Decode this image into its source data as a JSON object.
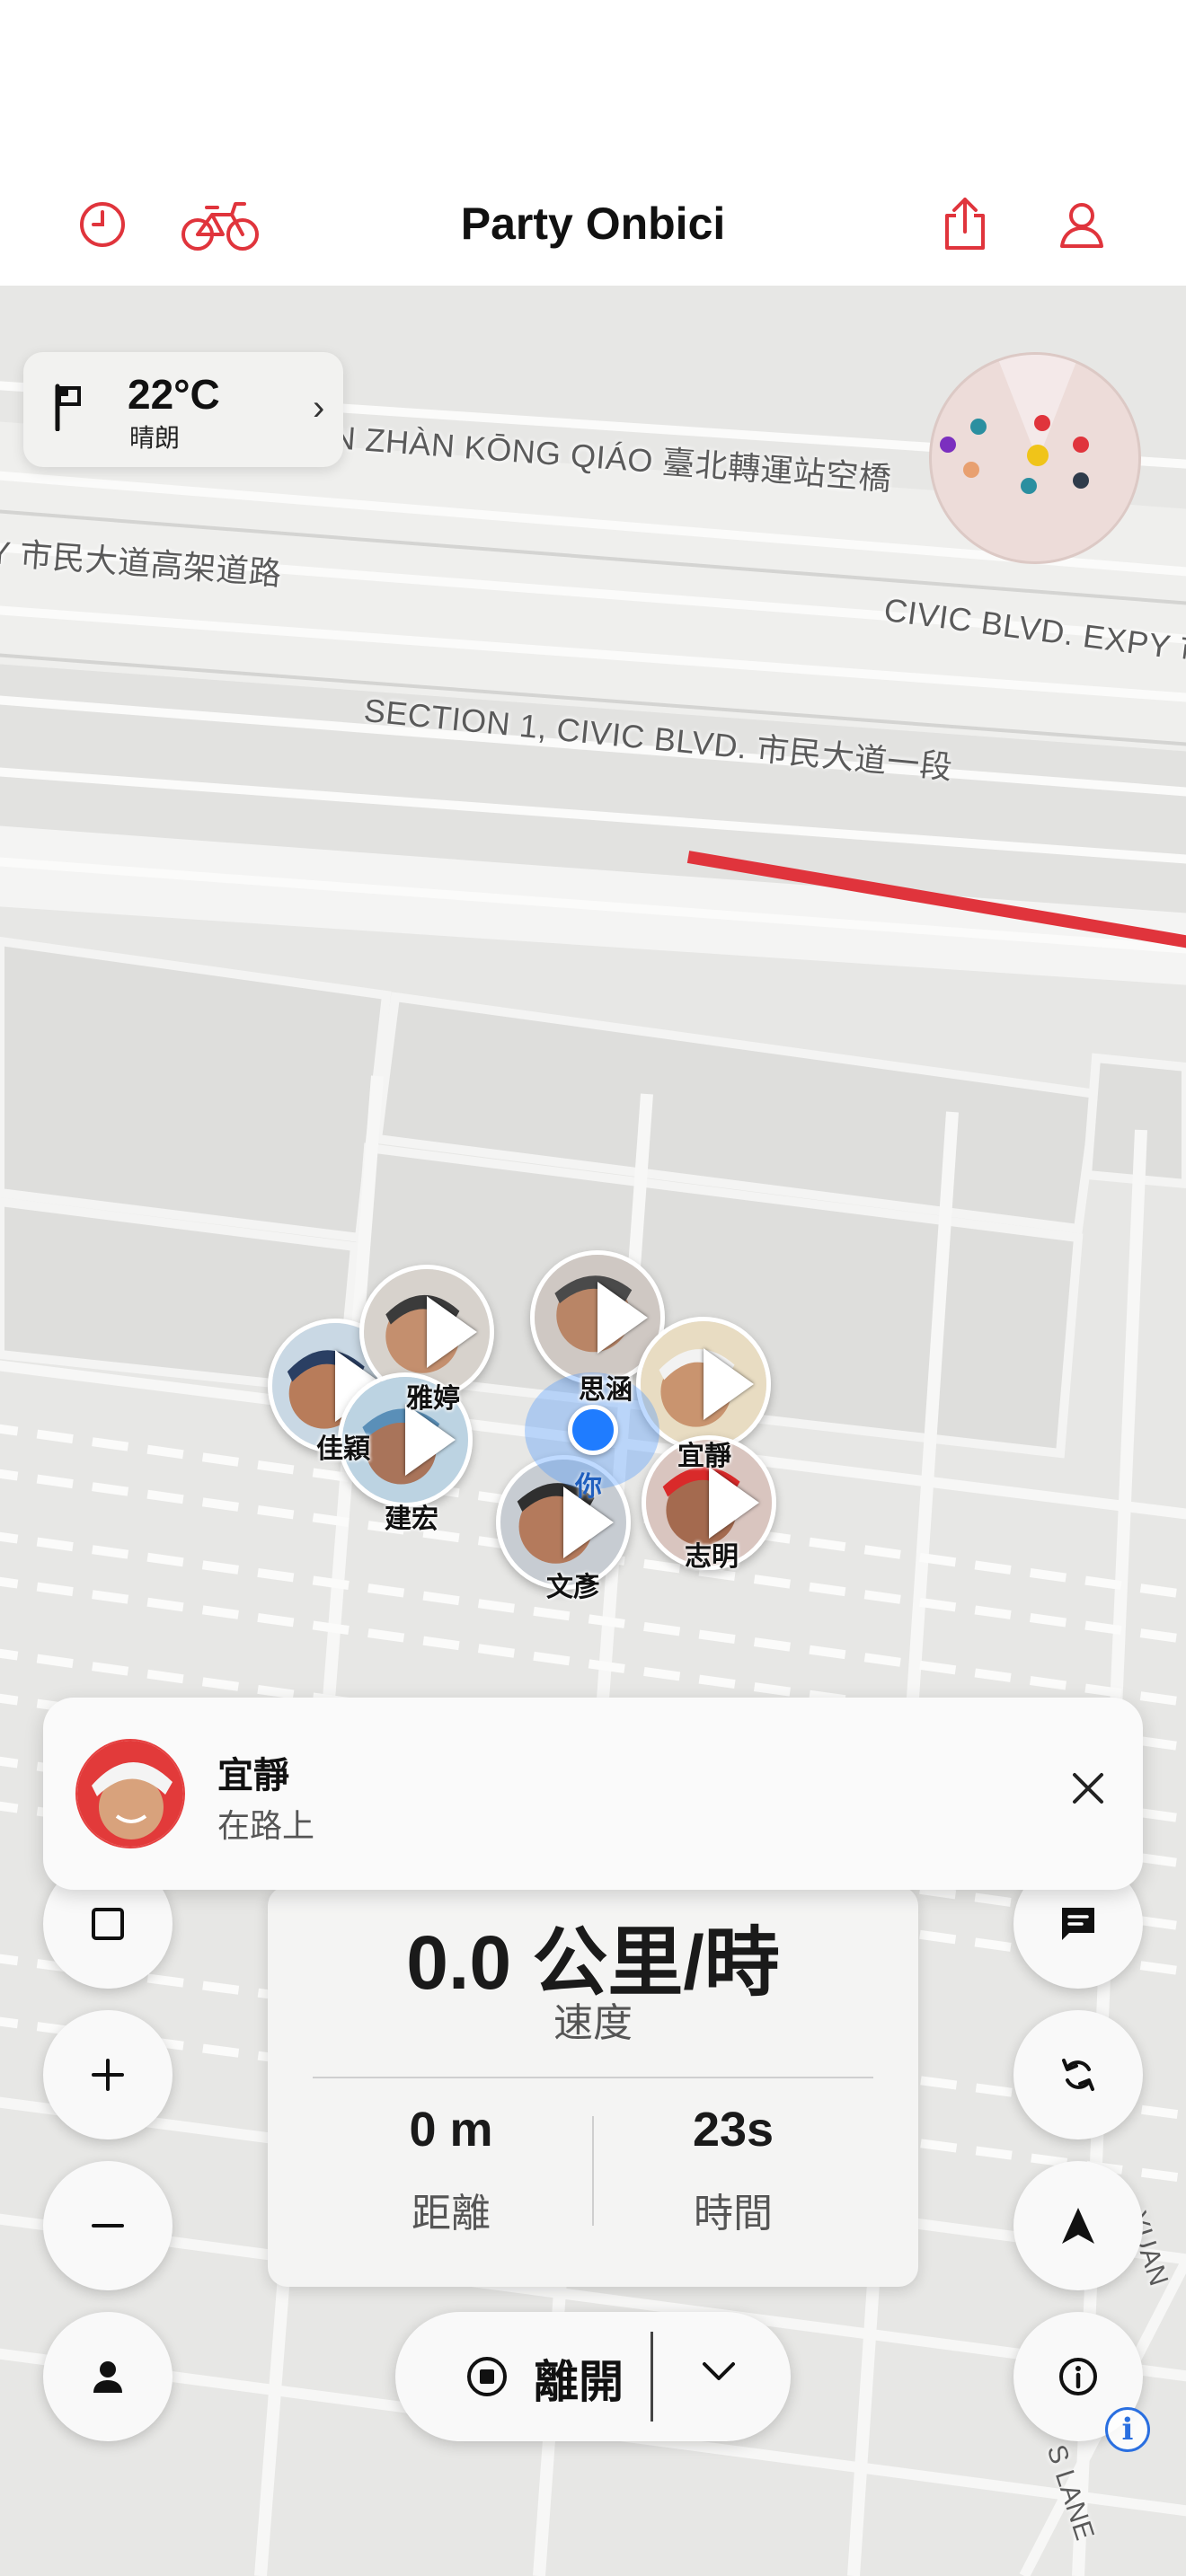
{
  "header": {
    "title": "Party Onbici",
    "icons": [
      "clock-icon",
      "bike-icon",
      "share-icon",
      "profile-icon"
    ],
    "accent_color": "#e0343c"
  },
  "weather": {
    "temperature": "22°C",
    "condition": "晴朗"
  },
  "map": {
    "road_labels": [
      "N ZHÀN KŌNG QIÁO 臺北轉運站空橋",
      "Y 市民大道高架道路",
      "CIVIC BLVD. EXPY 市",
      "SECTION 1, CIVIC BLVD. 市民大道一段",
      "YUAN",
      "S LANE"
    ],
    "radar_dot_colors": [
      "#7b2fbf",
      "#2b8fa0",
      "#e0343c",
      "#f0c419",
      "#e0343c",
      "#e8a070",
      "#2b8fa0",
      "#2f3b4a"
    ]
  },
  "riders": [
    {
      "name": "佳穎"
    },
    {
      "name": "雅婷"
    },
    {
      "name": "建宏"
    },
    {
      "name": "思涵"
    },
    {
      "name": "宜靜"
    },
    {
      "name": "文彥"
    },
    {
      "name": "志明"
    }
  ],
  "you_label": "你",
  "notification": {
    "name": "宜靜",
    "status": "在路上"
  },
  "stats": {
    "speed": "0.0 公里/時",
    "speed_label": "速度",
    "distance": "0 m",
    "distance_label": "距離",
    "time": "23s",
    "time_label": "時間"
  },
  "leave_button": {
    "label": "離開"
  }
}
